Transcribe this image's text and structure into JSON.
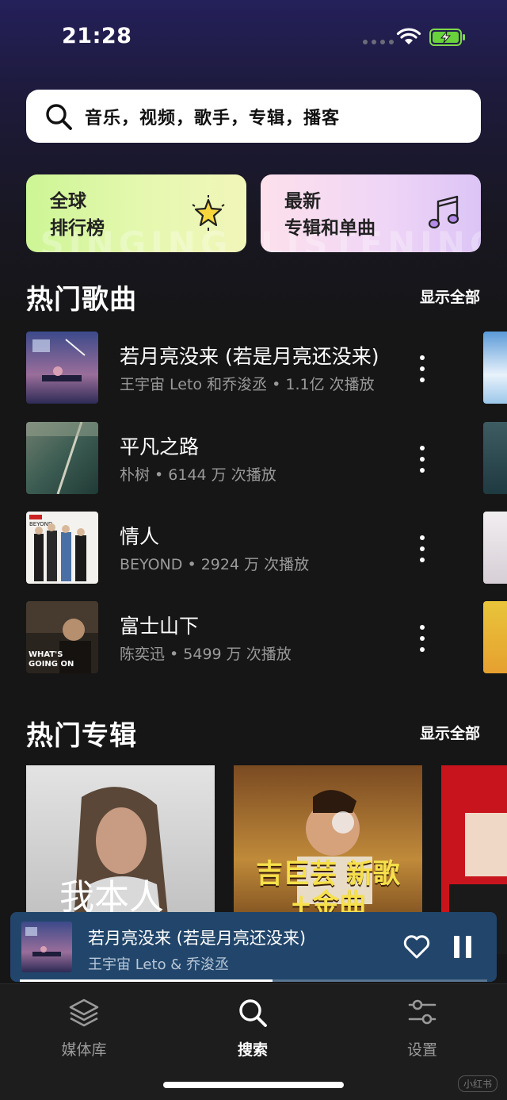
{
  "status_bar": {
    "time": "21:28"
  },
  "search": {
    "placeholder": "音乐，视频，歌手，专辑，播客"
  },
  "cards": {
    "global_chart": {
      "line1": "全球",
      "line2": "排行榜",
      "watermark": "SINGING"
    },
    "new_releases": {
      "line1": "最新",
      "line2": "专辑和单曲",
      "watermark": "LISTENING"
    }
  },
  "hot_songs": {
    "title": "热门歌曲",
    "show_all": "显示全部",
    "items": [
      {
        "title": "若月亮没来 (若是月亮还没来)",
        "subtitle": "王宇宙 Leto 和乔浚丞 • 1.1亿 次播放"
      },
      {
        "title": "平凡之路",
        "subtitle": "朴树 • 6144 万 次播放"
      },
      {
        "title": "情人",
        "subtitle": "BEYOND • 2924 万 次播放"
      },
      {
        "title": "富士山下",
        "subtitle": "陈奕迅 • 5499 万 次播放"
      }
    ]
  },
  "hot_albums": {
    "title": "热门专辑",
    "show_all": "显示全部",
    "items": [
      {
        "cover_text": "我本人"
      },
      {
        "cover_text": "吉巨芸 新歌+金曲"
      },
      {
        "cover_text": ""
      }
    ]
  },
  "now_playing": {
    "title": "若月亮没来 (若是月亮还没来)",
    "artist": "王宇宙 Leto & 乔浚丞",
    "progress": 0.54
  },
  "tabs": [
    {
      "label": "媒体库",
      "icon": "layers-icon"
    },
    {
      "label": "搜索",
      "icon": "search-icon"
    },
    {
      "label": "设置",
      "icon": "sliders-icon"
    }
  ],
  "corner_badge": "小红书",
  "colors": {
    "accent_player": "#22466b",
    "card_left": "#d9f5a0",
    "card_right": "#ecd4f6",
    "subtitle_gray": "#9a9a9a"
  }
}
